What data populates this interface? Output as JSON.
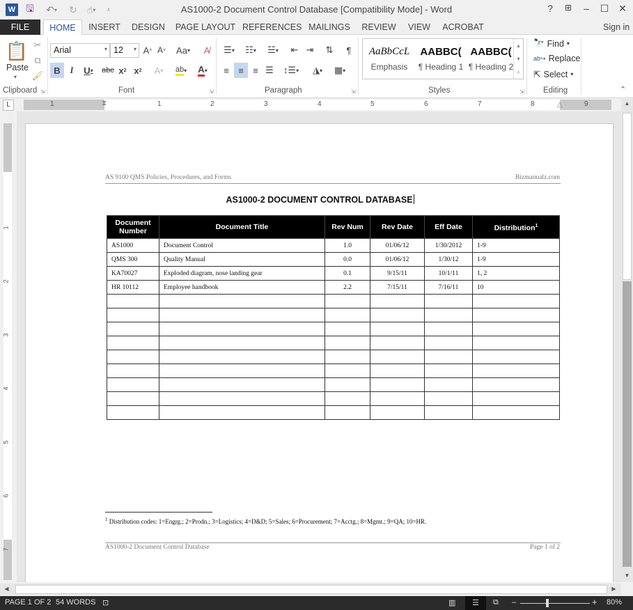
{
  "window": {
    "title": "AS1000-2 Document Control Database [Compatibility Mode] - Word",
    "app_icon": "word-icon",
    "quick_access": [
      "save-icon",
      "undo-icon",
      "redo-icon",
      "touch-mode-icon",
      "customize-qat-icon"
    ],
    "controls": {
      "help": "?",
      "ribbon_display": "⊞",
      "minimize": "–",
      "maximize": "☐",
      "close": "✕"
    }
  },
  "tabs": {
    "items": [
      {
        "label": "FILE"
      },
      {
        "label": "HOME"
      },
      {
        "label": "INSERT"
      },
      {
        "label": "DESIGN"
      },
      {
        "label": "PAGE LAYOUT"
      },
      {
        "label": "REFERENCES"
      },
      {
        "label": "MAILINGS"
      },
      {
        "label": "REVIEW"
      },
      {
        "label": "VIEW"
      },
      {
        "label": "ACROBAT"
      }
    ],
    "active": "HOME",
    "sign_in": "Sign in"
  },
  "ribbon": {
    "clipboard": {
      "label": "Clipboard",
      "paste": "Paste"
    },
    "font": {
      "label": "Font",
      "family": "Arial",
      "size": "12"
    },
    "paragraph": {
      "label": "Paragraph"
    },
    "styles": {
      "label": "Styles",
      "items": [
        {
          "preview": "AaBbCcL",
          "name": "Emphasis"
        },
        {
          "preview": "AABBC(",
          "name": "¶ Heading 1"
        },
        {
          "preview": "AABBC(",
          "name": "¶ Heading 2"
        }
      ]
    },
    "editing": {
      "label": "Editing",
      "find": "Find",
      "replace": "Replace",
      "select": "Select"
    }
  },
  "rulers": {
    "horizontal": [
      "1",
      "1",
      "2",
      "3",
      "4",
      "5",
      "6",
      "7",
      "8",
      "9"
    ],
    "vertical": [
      "1",
      "2",
      "3",
      "4",
      "5",
      "6",
      "7"
    ]
  },
  "document": {
    "header_left": "AS 9100 QMS Policies, Procedures, and Forms",
    "header_right": "Bizmanualz.com",
    "title": "AS1000-2 DOCUMENT CONTROL DATABASE",
    "table": {
      "headers": [
        "Document Number",
        "Document Title",
        "Rev Num",
        "Rev Date",
        "Eff Date",
        "Distribution"
      ],
      "header_sup": "1",
      "rows": [
        [
          "AS1000",
          "Document Control",
          "1.0",
          "01/06/12",
          "1/30/2012",
          "1-9"
        ],
        [
          "QMS 300",
          "Quality Manual",
          "0.0",
          "01/06/12",
          "1/30/12",
          "1-9"
        ],
        [
          "KA70027",
          "Exploded diagram, nose landing gear",
          "0.1",
          "9/15/11",
          "10/1/11",
          "1, 2"
        ],
        [
          "HR 10112",
          "Employee handbook",
          "2.2",
          "7/15/11",
          "7/16/11",
          "10"
        ],
        [
          "",
          "",
          "",
          "",
          "",
          ""
        ],
        [
          "",
          "",
          "",
          "",
          "",
          ""
        ],
        [
          "",
          "",
          "",
          "",
          "",
          ""
        ],
        [
          "",
          "",
          "",
          "",
          "",
          ""
        ],
        [
          "",
          "",
          "",
          "",
          "",
          ""
        ],
        [
          "",
          "",
          "",
          "",
          "",
          ""
        ],
        [
          "",
          "",
          "",
          "",
          "",
          ""
        ],
        [
          "",
          "",
          "",
          "",
          "",
          ""
        ],
        [
          "",
          "",
          "",
          "",
          "",
          ""
        ]
      ]
    },
    "footnote_mark": "1",
    "footnote": "Distribution codes: 1=Engrg.; 2=Prodn.; 3=Logistics; 4=D&D; 5=Sales; 6=Procurement; 7=Acctg.; 8=Mgmt.; 9=QA; 10=HR.",
    "footer_left": "AS1000-2 Document Control Database",
    "footer_right": "Page 1 of 2"
  },
  "statusbar": {
    "page": "PAGE 1 OF 2",
    "words": "54 WORDS",
    "zoom": "80%",
    "zoom_percent": 80
  },
  "colors": {
    "accent": "#2b579a",
    "statusbar": "#2b2b2b",
    "table_header": "#000000"
  }
}
